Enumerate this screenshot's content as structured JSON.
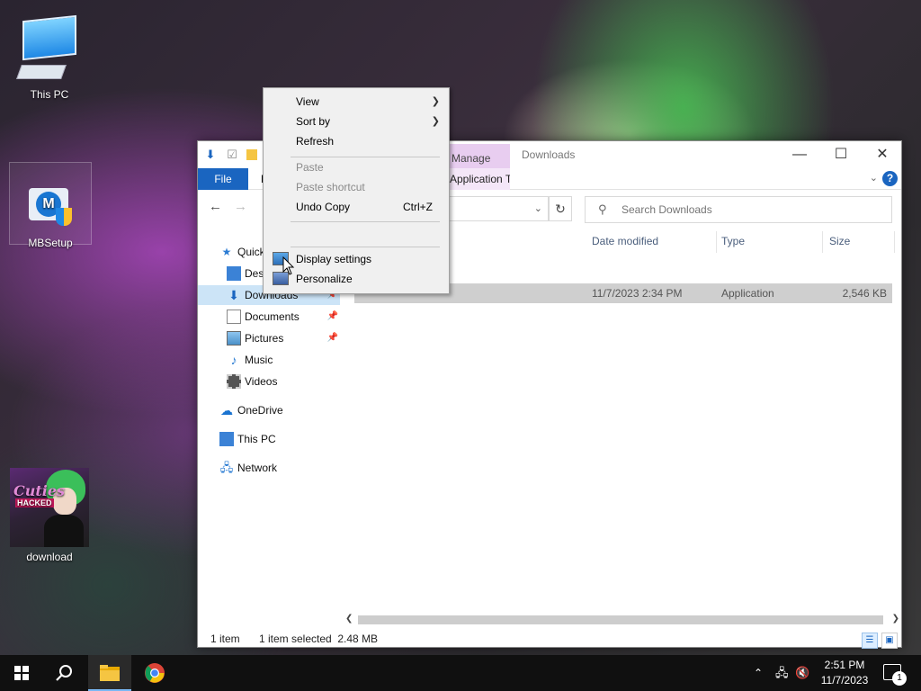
{
  "desktop": {
    "icons": [
      {
        "label": "This PC"
      },
      {
        "label": "MBSetup"
      },
      {
        "label": "download"
      }
    ],
    "download_thumb": {
      "title": "Cuties",
      "badge": "HACKED"
    }
  },
  "explorer": {
    "title": "Downloads",
    "context_tab": "Manage",
    "ribbon_tabs": {
      "file": "File",
      "home": "H",
      "application_tools": "Application Tools"
    },
    "search_placeholder": "Search Downloads",
    "sidebar": {
      "items": [
        {
          "label": "Quick access",
          "icon": "star-icon"
        },
        {
          "label": "Desktop",
          "icon": "desktop-icon",
          "pinned": true
        },
        {
          "label": "Downloads",
          "icon": "download-arrow-icon",
          "pinned": true,
          "selected": true
        },
        {
          "label": "Documents",
          "icon": "documents-icon",
          "pinned": true
        },
        {
          "label": "Pictures",
          "icon": "pictures-icon",
          "pinned": true
        },
        {
          "label": "Music",
          "icon": "music-icon"
        },
        {
          "label": "Videos",
          "icon": "videos-icon"
        },
        {
          "label": "OneDrive",
          "icon": "cloud-icon"
        },
        {
          "label": "This PC",
          "icon": "computer-icon"
        },
        {
          "label": "Network",
          "icon": "network-icon"
        }
      ]
    },
    "columns": {
      "date_modified": "Date modified",
      "type": "Type",
      "size": "Size"
    },
    "rows": [
      {
        "date_modified": "11/7/2023 2:34 PM",
        "type": "Application",
        "size": "2,546 KB"
      }
    ],
    "status": {
      "count": "1 item",
      "selected": "1 item selected  2.48 MB"
    }
  },
  "context_menu": {
    "view": "View",
    "sort_by": "Sort by",
    "refresh": "Refresh",
    "paste": "Paste",
    "paste_shortcut": "Paste shortcut",
    "undo_copy": "Undo Copy",
    "undo_shortcut": "Ctrl+Z",
    "display_settings": "Display settings",
    "personalize": "Personalize"
  },
  "taskbar": {
    "time": "2:51 PM",
    "date": "11/7/2023",
    "notification_count": "1"
  }
}
